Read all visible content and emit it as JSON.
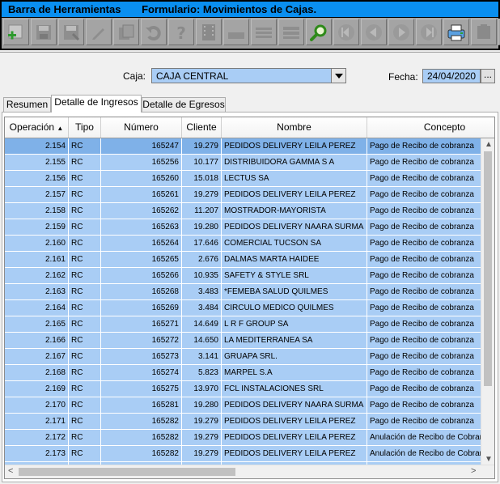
{
  "titlebar": {
    "left": "Barra de Herramientas",
    "right": "Formulario: Movimientos de Cajas."
  },
  "toolbar": {
    "buttons": [
      {
        "name": "add-icon"
      },
      {
        "name": "save-icon"
      },
      {
        "name": "save-as-icon"
      },
      {
        "name": "edit-icon"
      },
      {
        "name": "copy-icon"
      },
      {
        "name": "undo-icon"
      },
      {
        "name": "help-icon"
      },
      {
        "name": "film-icon"
      },
      {
        "name": "image-icon"
      },
      {
        "name": "list-icon"
      },
      {
        "name": "table-icon"
      },
      {
        "name": "search-icon"
      },
      {
        "name": "first-icon"
      },
      {
        "name": "prev-icon"
      },
      {
        "name": "next-icon"
      },
      {
        "name": "last-icon"
      },
      {
        "name": "print-icon"
      },
      {
        "name": "export-icon"
      },
      {
        "name": "home-icon"
      }
    ]
  },
  "form": {
    "caja_label": "Caja:",
    "caja_value": "CAJA CENTRAL",
    "fecha_label": "Fecha:",
    "fecha_value": "24/04/2020",
    "fecha_button": "..."
  },
  "tabs": [
    {
      "label": "Resumen"
    },
    {
      "label": "Detalle de Ingresos"
    },
    {
      "label": "Detalle de Egresos"
    }
  ],
  "grid": {
    "columns": [
      "Operación",
      "Tipo",
      "Número",
      "Cliente",
      "Nombre",
      "Concepto"
    ],
    "sort_indicator": "▲",
    "rows": [
      [
        "2.154",
        "RC",
        "165247",
        "19.279",
        "PEDIDOS DELIVERY LEILA PEREZ",
        "Pago de Recibo de cobranza"
      ],
      [
        "2.155",
        "RC",
        "165256",
        "10.177",
        "DISTRIBUIDORA GAMMA S A",
        "Pago de Recibo de cobranza"
      ],
      [
        "2.156",
        "RC",
        "165260",
        "15.018",
        "LECTUS SA",
        "Pago de Recibo de cobranza"
      ],
      [
        "2.157",
        "RC",
        "165261",
        "19.279",
        "PEDIDOS DELIVERY LEILA PEREZ",
        "Pago de Recibo de cobranza"
      ],
      [
        "2.158",
        "RC",
        "165262",
        "11.207",
        "MOSTRADOR-MAYORISTA",
        "Pago de Recibo de cobranza"
      ],
      [
        "2.159",
        "RC",
        "165263",
        "19.280",
        "PEDIDOS DELIVERY NAARA SURMA",
        "Pago de Recibo de cobranza"
      ],
      [
        "2.160",
        "RC",
        "165264",
        "17.646",
        "COMERCIAL TUCSON SA",
        "Pago de Recibo de cobranza"
      ],
      [
        "2.161",
        "RC",
        "165265",
        "2.676",
        "DALMAS MARTA HAIDEE",
        "Pago de Recibo de cobranza"
      ],
      [
        "2.162",
        "RC",
        "165266",
        "10.935",
        "SAFETY & STYLE SRL",
        "Pago de Recibo de cobranza"
      ],
      [
        "2.163",
        "RC",
        "165268",
        "3.483",
        "*FEMEBA SALUD QUILMES",
        "Pago de Recibo de cobranza"
      ],
      [
        "2.164",
        "RC",
        "165269",
        "3.484",
        "CIRCULO MEDICO QUILMES",
        "Pago de Recibo de cobranza"
      ],
      [
        "2.165",
        "RC",
        "165271",
        "14.649",
        "L R F GROUP SA",
        "Pago de Recibo de cobranza"
      ],
      [
        "2.166",
        "RC",
        "165272",
        "14.650",
        "LA MEDITERRANEA SA",
        "Pago de Recibo de cobranza"
      ],
      [
        "2.167",
        "RC",
        "165273",
        "3.141",
        "GRUAPA SRL.",
        "Pago de Recibo de cobranza"
      ],
      [
        "2.168",
        "RC",
        "165274",
        "5.823",
        "MARPEL S.A",
        "Pago de Recibo de cobranza"
      ],
      [
        "2.169",
        "RC",
        "165275",
        "13.970",
        "FCL INSTALACIONES SRL",
        "Pago de Recibo de cobranza"
      ],
      [
        "2.170",
        "RC",
        "165281",
        "19.280",
        "PEDIDOS DELIVERY NAARA SURMA",
        "Pago de Recibo de cobranza"
      ],
      [
        "2.171",
        "RC",
        "165282",
        "19.279",
        "PEDIDOS DELIVERY LEILA PEREZ",
        "Pago de Recibo de cobranza"
      ],
      [
        "2.172",
        "RC",
        "165282",
        "19.279",
        "PEDIDOS DELIVERY LEILA PEREZ",
        "Anulación de Recibo de Cobranza"
      ],
      [
        "2.173",
        "RC",
        "165282",
        "19.279",
        "PEDIDOS DELIVERY LEILA PEREZ",
        "Anulación de Recibo de Cobranza"
      ],
      [
        "",
        "",
        "",
        "",
        "",
        ""
      ]
    ]
  },
  "scroll": {
    "up": "▲",
    "down": "▼",
    "left": "<",
    "right": ">"
  },
  "colors": {
    "title_bg": "#0a8ff0",
    "row_bg": "#a9cdf5",
    "row_selected_bg": "#7fb1e8",
    "toolbar_bg": "#9e9e9e"
  }
}
